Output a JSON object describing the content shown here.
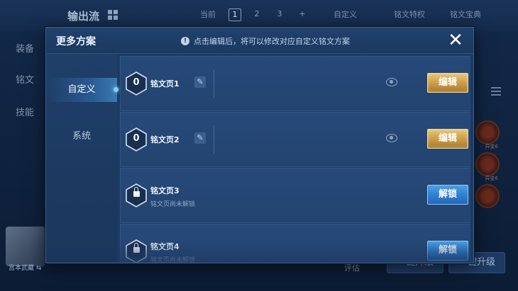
{
  "background": {
    "title": "输出流",
    "side_items": [
      "装备",
      "铭文",
      "技能"
    ],
    "top_right": {
      "current_label": "当前",
      "pages": [
        "1",
        "2",
        "3"
      ],
      "add": "+",
      "custom": "自定义",
      "special": "铭文特权",
      "treasure": "铭文宝典"
    },
    "hero_name": "宫本武藏",
    "hero_switch": "⇆",
    "rune_labels": [
      "异变6",
      "异变6"
    ],
    "bottom_left_label": "评估",
    "btn_upgrade": "一键升级",
    "btn_combine": "一键升级"
  },
  "modal": {
    "title": "更多方案",
    "hint_icon": "!",
    "hint": "点击编辑后，将可以修改对应自定义铭文方案",
    "close_label": "✕",
    "tabs": [
      {
        "label": "自定义",
        "active": true
      },
      {
        "label": "系统",
        "active": false
      }
    ],
    "rows": [
      {
        "name": "铭文页1",
        "level": "0",
        "locked": false,
        "button": "编辑",
        "edit_icon": "✎"
      },
      {
        "name": "铭文页2",
        "level": "0",
        "locked": false,
        "button": "编辑",
        "edit_icon": "✎"
      },
      {
        "name": "铭文页3",
        "locked": true,
        "sub": "铭文页尚未解锁",
        "button": "解锁"
      },
      {
        "name": "铭文页4",
        "locked": true,
        "sub": "铭文页尚未解锁",
        "button": "解锁"
      }
    ]
  },
  "colors": {
    "edit_button": "#c99a45",
    "unlock_button": "#2f7fd0",
    "modal_bg": "#1d3a63"
  }
}
